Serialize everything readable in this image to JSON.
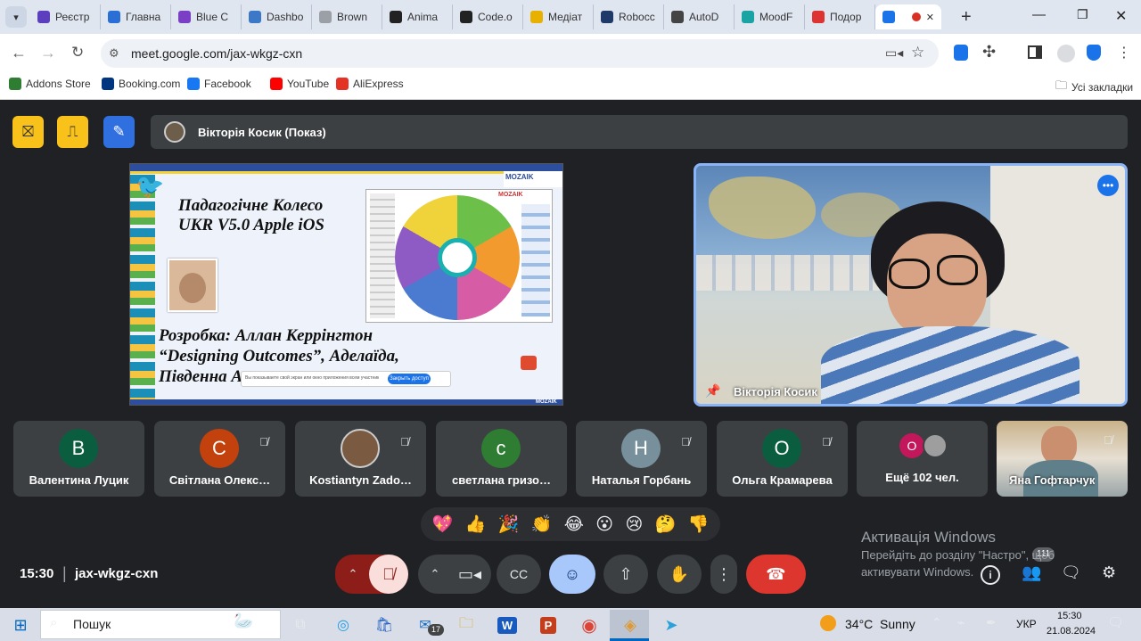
{
  "browser": {
    "tabs": [
      {
        "label": "Реєстр",
        "icon": "forms-icon",
        "color": "#5c3fbf"
      },
      {
        "label": "Главна",
        "icon": "globe-icon",
        "color": "#2a6fd6"
      },
      {
        "label": "Blue C",
        "icon": "chat-icon",
        "color": "#7a3fc4"
      },
      {
        "label": "Dashbo",
        "icon": "globe-icon",
        "color": "#3b78c7"
      },
      {
        "label": "Brown",
        "icon": "doc-icon",
        "color": "#9aa0a6"
      },
      {
        "label": "Anima",
        "icon": "a-icon",
        "color": "#222"
      },
      {
        "label": "Code.o",
        "icon": "grid-icon",
        "color": "#222"
      },
      {
        "label": "Медіат",
        "icon": "media-icon",
        "color": "#e8b100"
      },
      {
        "label": "Robocc",
        "icon": "a-icon",
        "color": "#1f3a68"
      },
      {
        "label": "AutoD",
        "icon": "draw-icon",
        "color": "#444"
      },
      {
        "label": "MoodF",
        "icon": "mood-icon",
        "color": "#1aa3a3"
      },
      {
        "label": "Подор",
        "icon": "gallery-icon",
        "color": "#d33"
      },
      {
        "label": "",
        "icon": "meet-icon",
        "color": "#1a73e8",
        "active": true
      }
    ],
    "url": "meet.google.com/jax-wkgz-cxn",
    "bookmarks": [
      {
        "label": "Addons Store",
        "color": "#2e7d32"
      },
      {
        "label": "Booking.com",
        "color": "#003580"
      },
      {
        "label": "Facebook",
        "color": "#1877f2"
      },
      {
        "label": "YouTube",
        "color": "#ff0000"
      },
      {
        "label": "AliExpress",
        "color": "#e43225"
      }
    ],
    "all_bookmarks": "Усі закладки"
  },
  "meet": {
    "presenter_label": "Вікторія Косик (Показ)",
    "slide": {
      "title_line1": "Падагогічне Колесо",
      "title_line2": "UKR V5.0 Apple iOS",
      "author_line1": "Розробка: Аллан Керрінгтон",
      "author_line2": "“Designing Outcomes”, Аделаїда,",
      "author_line3": "Південна А",
      "logo": "MOZAIK",
      "popup_button": "Закрыть доступ",
      "popup_text": "Вы показываете свой экран или окно приложения всем участникам"
    },
    "speaker": {
      "name": "Вікторія Косик"
    },
    "participants": [
      {
        "initial": "В",
        "name": "Валентина Луцик",
        "color": "#0b5d40",
        "muted": false
      },
      {
        "initial": "С",
        "name": "Світлана Олекс…",
        "color": "#c2410c",
        "muted": true
      },
      {
        "initial": "",
        "name": "Kostiantyn Zado…",
        "color": "#7a5a40",
        "muted": true,
        "photo": true
      },
      {
        "initial": "с",
        "name": "светлана гризо…",
        "color": "#2e7d32",
        "muted": false
      },
      {
        "initial": "Н",
        "name": "Наталья Горбань",
        "color": "#78909c",
        "muted": true
      },
      {
        "initial": "О",
        "name": "Ольга Крамарева",
        "color": "#0b5d40",
        "muted": true
      }
    ],
    "more": {
      "label": "Ещё 102 чел.",
      "initial": "О"
    },
    "self_tile": {
      "name": "Яна Гофтарчук"
    },
    "reactions": [
      "💖",
      "👍",
      "🎉",
      "👏",
      "😂",
      "😮",
      "😢",
      "🤔",
      "👎"
    ],
    "time": "15:30",
    "meeting_code": "jax-wkgz-cxn",
    "participant_badge": "111",
    "activation_title": "Активація Windows",
    "activation_text1": "Перейдіть до розділу \"Настро",
    "activation_text1b": "\", щоб",
    "activation_text2": "активувати Windows."
  },
  "taskbar": {
    "search_placeholder": "Пошук",
    "weather": "34°C  Sunny",
    "lang": "УКР",
    "clock_time": "15:30",
    "clock_date": "21.08.2024",
    "mail_badge": "17"
  }
}
